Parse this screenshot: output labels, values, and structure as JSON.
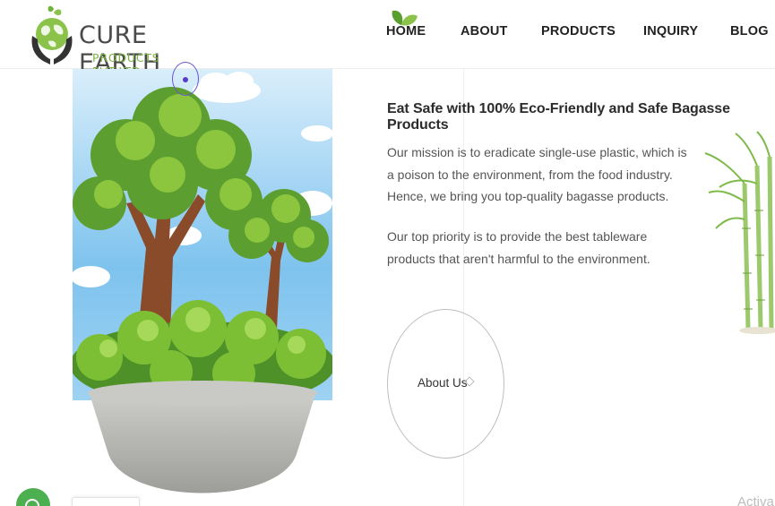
{
  "brand": {
    "name": "CURE EARTH",
    "subtitle": "PRODUCTS PVT.LTD."
  },
  "nav": {
    "items": [
      {
        "label": "HOME"
      },
      {
        "label": "ABOUT"
      },
      {
        "label": "PRODUCTS"
      },
      {
        "label": "INQUIRY"
      },
      {
        "label": "BLOG"
      }
    ]
  },
  "content": {
    "headline": "Eat Safe with 100% Eco-Friendly and Safe Bagasse Products",
    "para1": "Our mission is to eradicate single-use plastic, which is a poison to the environment, from the food industry. Hence, we bring you top-quality bagasse products.",
    "para2": "Our top priority is to provide the best tableware products that aren't harmful to the environment.",
    "about_button": "About Us"
  },
  "watermark": {
    "text": "Activa"
  },
  "colors": {
    "brand_green": "#7cb342",
    "leaf_green": "#4caf50",
    "text_dark": "#2b2b2b"
  },
  "icons": {
    "logo": "earth-in-hands-icon",
    "nav_leaf": "leaf-icon",
    "chat": "chat-icon"
  }
}
